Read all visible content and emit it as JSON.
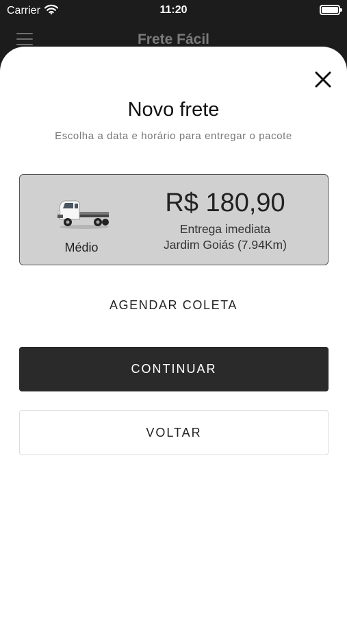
{
  "status_bar": {
    "carrier": "Carrier",
    "time": "11:20",
    "icons": [
      "wifi-icon",
      "battery-icon"
    ]
  },
  "header": {
    "title": "Frete Fácil",
    "menu_icon": "menu-icon"
  },
  "sheet": {
    "close_icon": "close-icon",
    "title": "Novo frete",
    "subtitle": "Escolha a data e horário para entregar o pacote",
    "vehicle_card": {
      "vehicle_icon": "truck-icon",
      "vehicle_size": "Médio",
      "price": "R$ 180,90",
      "delivery_type": "Entrega imediata",
      "destination": "Jardim Goiás (7.94Km)"
    },
    "schedule_label": "AGENDAR COLETA",
    "continue_label": "CONTINUAR",
    "back_label": "VOLTAR"
  },
  "colors": {
    "background_dark": "#1c1c1c",
    "sheet": "#ffffff",
    "card_bg": "#d0d0d0",
    "primary_button": "#2a2a2a"
  }
}
